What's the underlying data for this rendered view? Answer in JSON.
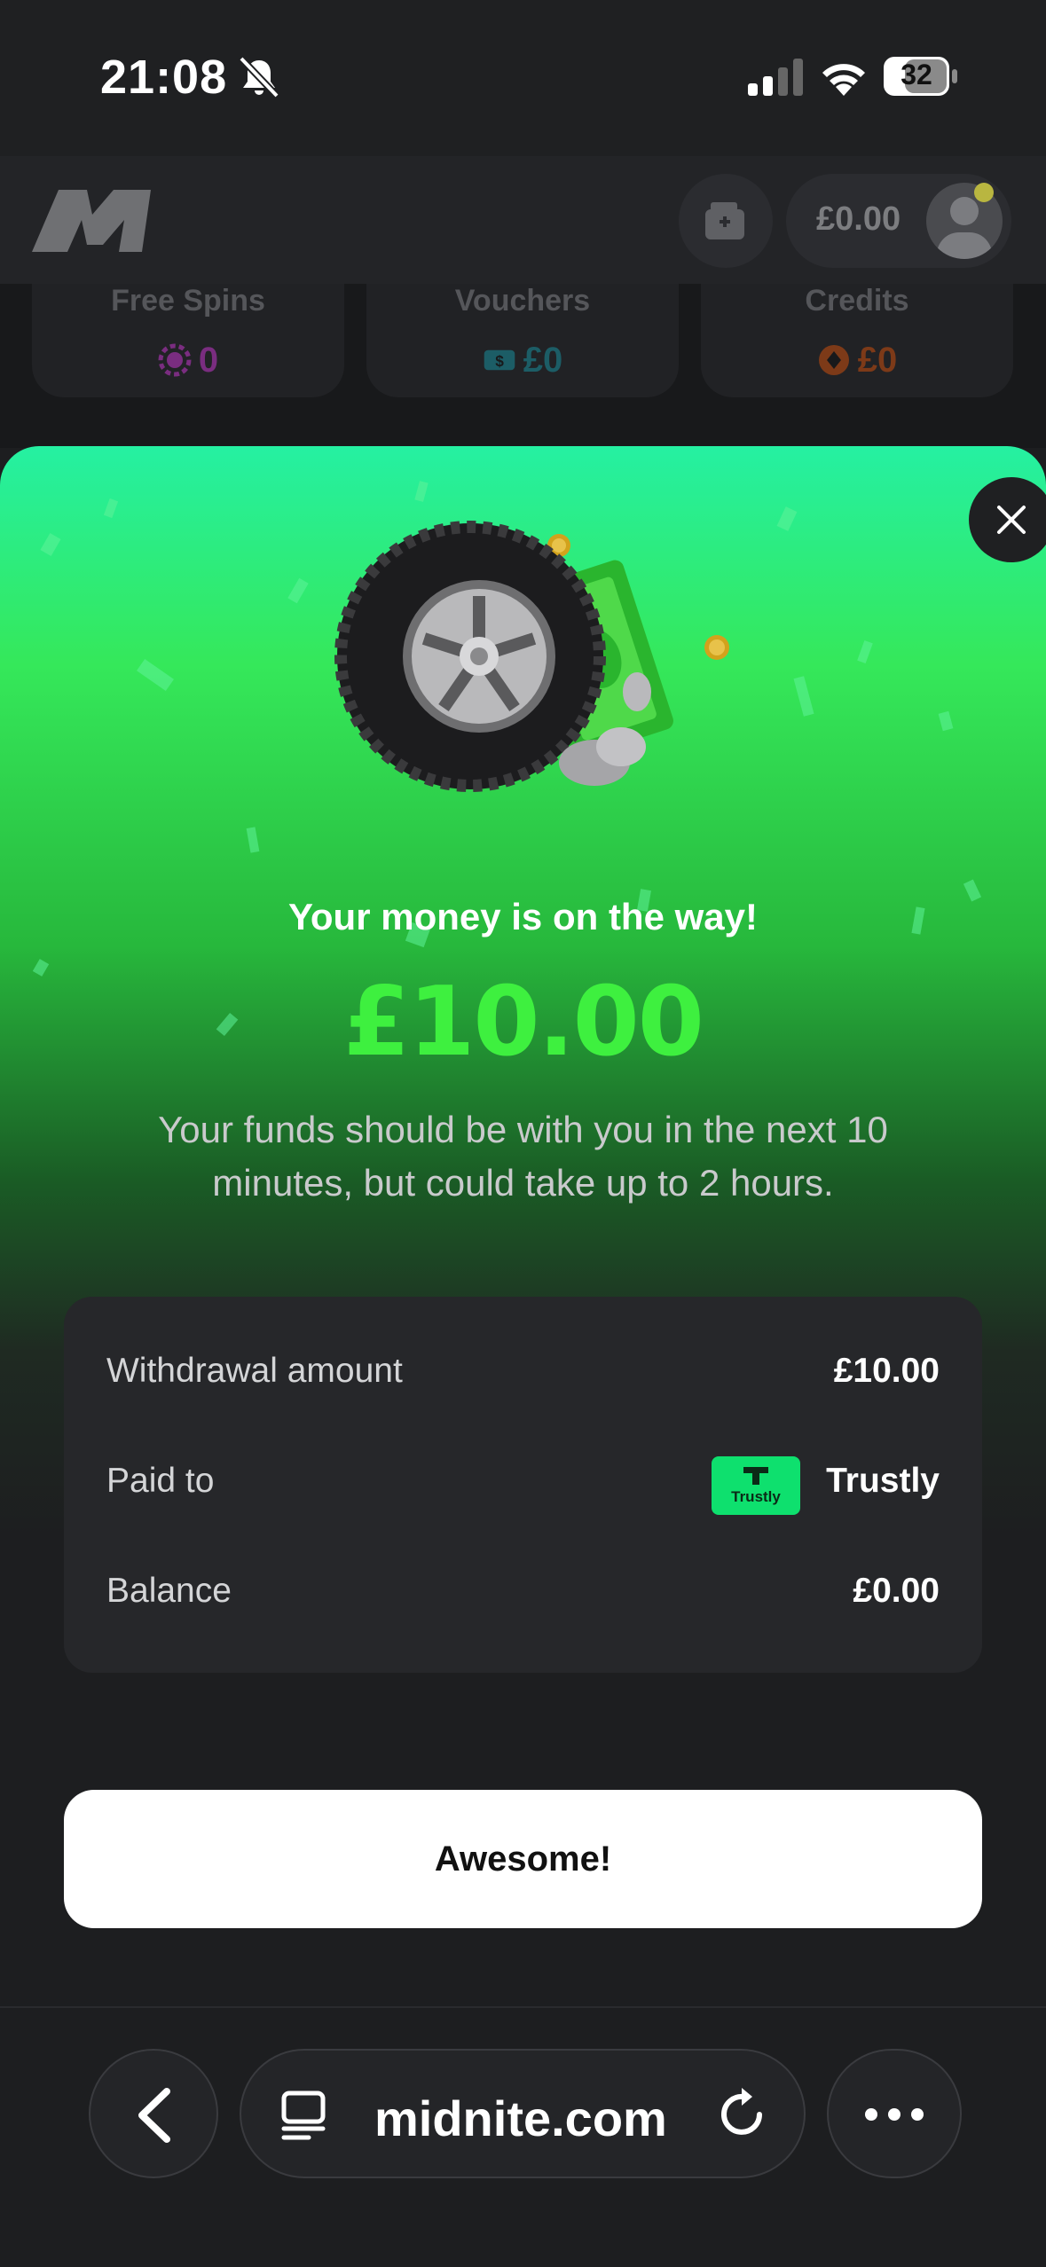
{
  "status_bar": {
    "time": "21:08",
    "battery": "32",
    "icons": [
      "bell-slash-icon",
      "signal-icon",
      "wifi-icon",
      "battery-icon"
    ]
  },
  "header": {
    "logo": "M",
    "balance": "£0.00",
    "icons": [
      "wallet-plus-icon",
      "avatar-icon"
    ]
  },
  "rewards": [
    {
      "label": "Free Spins",
      "value": "0",
      "color": "#b03ab6",
      "icon": "spin-icon"
    },
    {
      "label": "Vouchers",
      "value": "£0",
      "color": "#1c8a95",
      "icon": "voucher-icon"
    },
    {
      "label": "Credits",
      "value": "£0",
      "color": "#c2521f",
      "icon": "credit-icon"
    }
  ],
  "modal": {
    "title": "Your money is on the way!",
    "amount": "£10.00",
    "description": "Your funds should be with you in the next 10 minutes, but could take up to 2 hours.",
    "details": {
      "withdrawal_label": "Withdrawal amount",
      "withdrawal_value": "£10.00",
      "paid_to_label": "Paid to",
      "paid_to_value": "Trustly",
      "paid_to_logo_text": "Trustly",
      "balance_label": "Balance",
      "balance_value": "£0.00"
    },
    "button_label": "Awesome!",
    "accent_color": "#3ef03f"
  },
  "browser": {
    "url": "midnite.com",
    "icons": [
      "back-icon",
      "tabs-icon",
      "reload-icon",
      "more-icon"
    ]
  }
}
